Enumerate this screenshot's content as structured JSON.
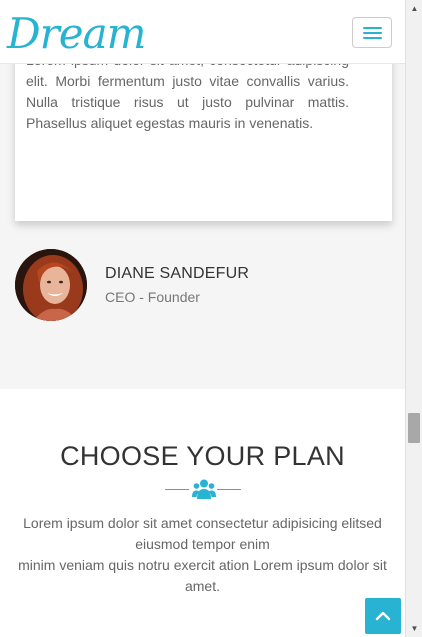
{
  "navbar": {
    "brand": "Dream",
    "menu_icon": "hamburger-menu-icon"
  },
  "testimonial": {
    "quote": "Lorem ipsum dolor sit amet, consectetur adipiscing elit. Morbi fermentum justo vitae convallis varius. Nulla tristique risus ut justo pulvinar mattis. Phasellus aliquet egestas mauris in venenatis.",
    "author_name": "DIANE SANDEFUR",
    "author_role": "CEO - Founder"
  },
  "plan": {
    "title": "CHOOSE YOUR PLAN",
    "icon": "users-icon",
    "description_line1": "Lorem ipsum dolor sit amet consectetur adipisicing elitsed eiusmod tempor enim",
    "description_line2": "minim veniam quis notru exercit ation Lorem ipsum dolor sit amet."
  },
  "back_to_top": {
    "icon": "chevron-up-icon"
  },
  "colors": {
    "accent": "#27b3d1",
    "section_bg": "#f5f5f5"
  }
}
